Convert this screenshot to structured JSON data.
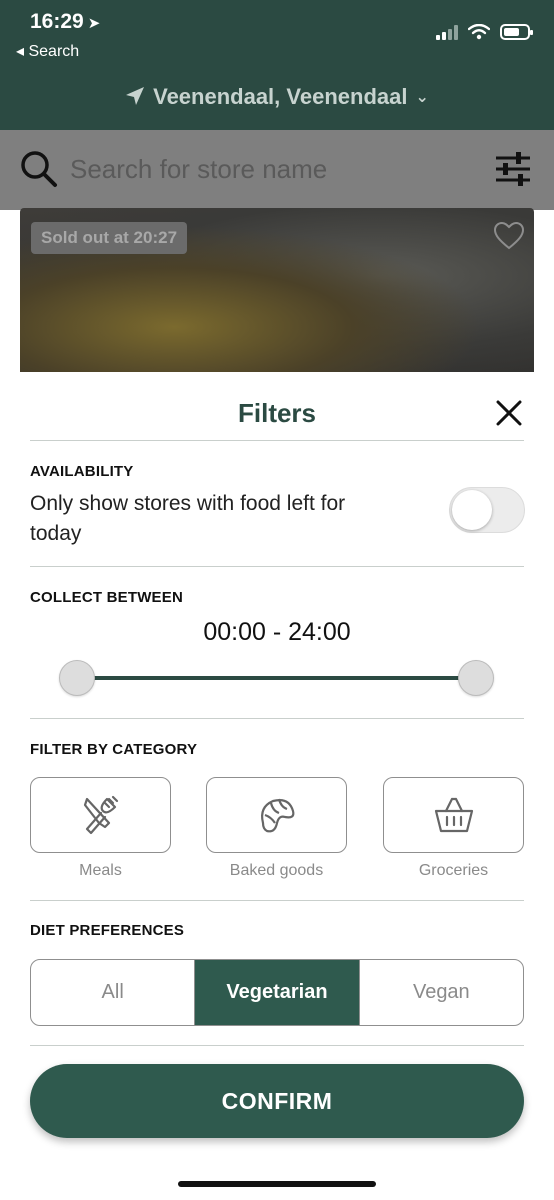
{
  "status_bar": {
    "time": "16:29",
    "back_label": "◂ Search"
  },
  "header": {
    "location": "Veenendaal, Veenendaal"
  },
  "search": {
    "placeholder": "Search for store name"
  },
  "store_card": {
    "badge": "Sold out at 20:27"
  },
  "filters": {
    "title": "Filters",
    "availability": {
      "label": "AVAILABILITY",
      "text": "Only show stores with food left for today",
      "enabled": false
    },
    "collect": {
      "label": "COLLECT BETWEEN",
      "range": "00:00 - 24:00"
    },
    "category": {
      "label": "FILTER BY CATEGORY",
      "items": [
        {
          "label": "Meals",
          "icon": "cutlery-icon"
        },
        {
          "label": "Baked goods",
          "icon": "croissant-icon"
        },
        {
          "label": "Groceries",
          "icon": "basket-icon"
        }
      ]
    },
    "diet": {
      "label": "DIET PREFERENCES",
      "options": [
        "All",
        "Vegetarian",
        "Vegan"
      ],
      "selected": "Vegetarian"
    },
    "confirm_label": "CONFIRM"
  },
  "colors": {
    "brand_green": "#2b4a42",
    "accent_green": "#2f5a4e"
  }
}
